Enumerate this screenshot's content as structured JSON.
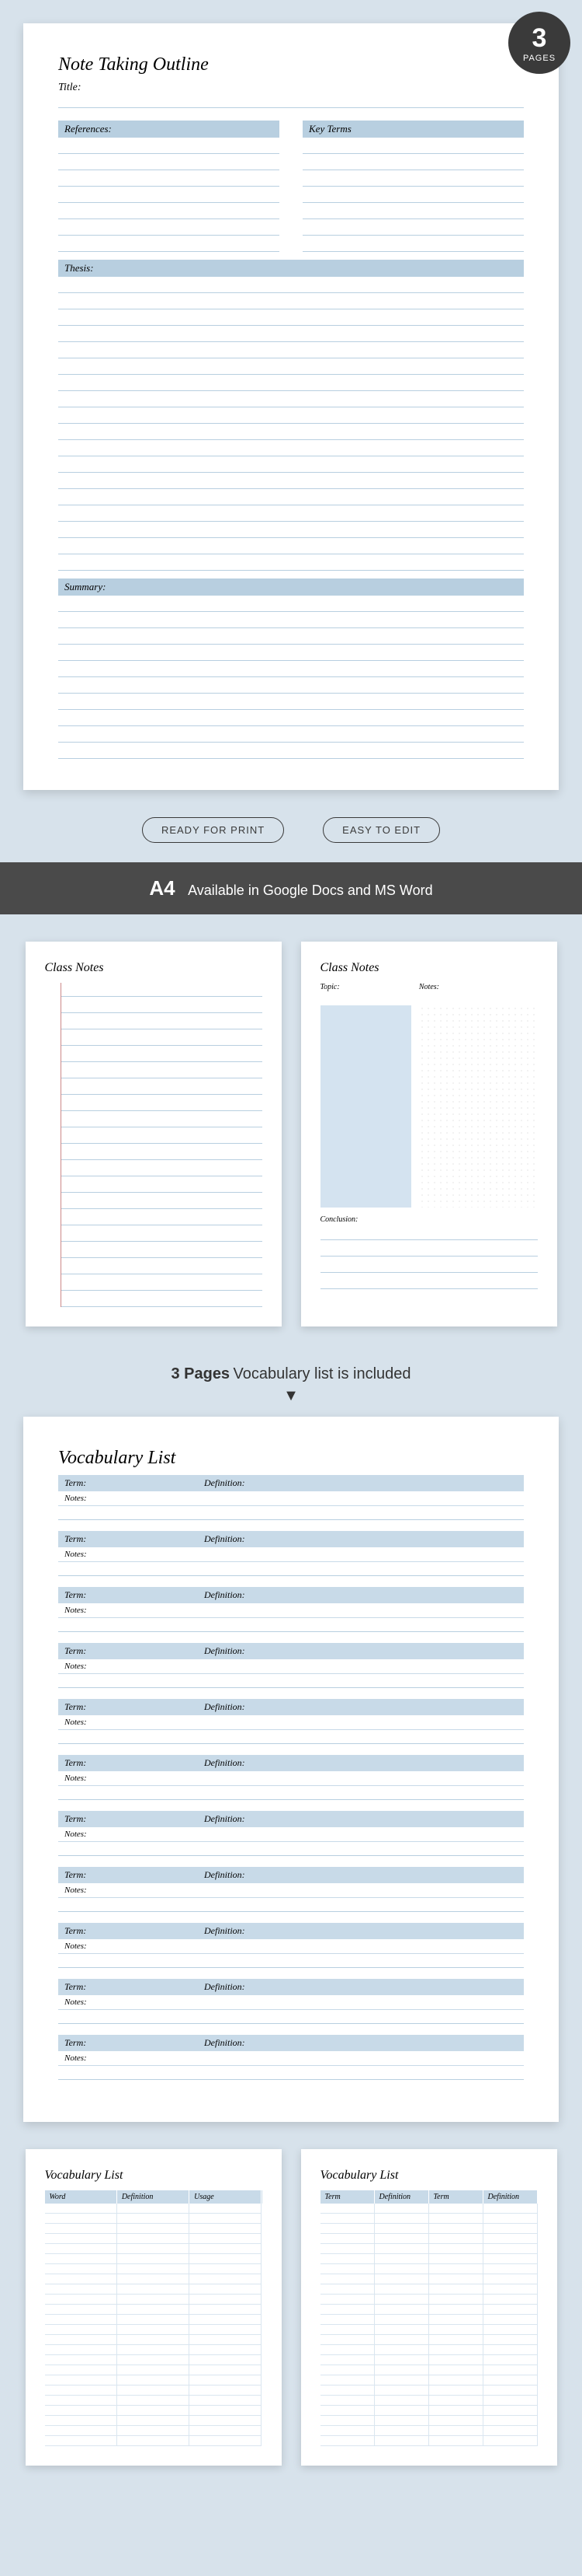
{
  "badge": {
    "num": "3",
    "txt": "PAGES"
  },
  "p1": {
    "title": "Note Taking Outline",
    "title_lbl": "Title:",
    "refs": "References:",
    "keyterms": "Key Terms",
    "thesis": "Thesis:",
    "summary": "Summary:"
  },
  "pills": {
    "a": "READY FOR PRINT",
    "b": "EASY TO EDIT"
  },
  "bar": {
    "a": "A4",
    "b": "Available in Google Docs and MS Word"
  },
  "thumbs": {
    "t1": "Class Notes",
    "t2": "Class Notes",
    "t2_topic": "Topic:",
    "t2_notes": "Notes:",
    "t2_concl": "Conclusion:"
  },
  "mid": {
    "a": "3 Pages",
    "b": "Vocabulary list is included"
  },
  "p2": {
    "title": "Vocabulary List",
    "term": "Term:",
    "def": "Definition:",
    "notes": "Notes:"
  },
  "thumbs2": {
    "t1": "Vocabulary List",
    "t2": "Vocabulary List",
    "c1": "Word",
    "c2": "Definition",
    "c3": "Usage",
    "c4": "Term",
    "c5": "Definition",
    "c6": "Term",
    "c7": "Definition"
  }
}
